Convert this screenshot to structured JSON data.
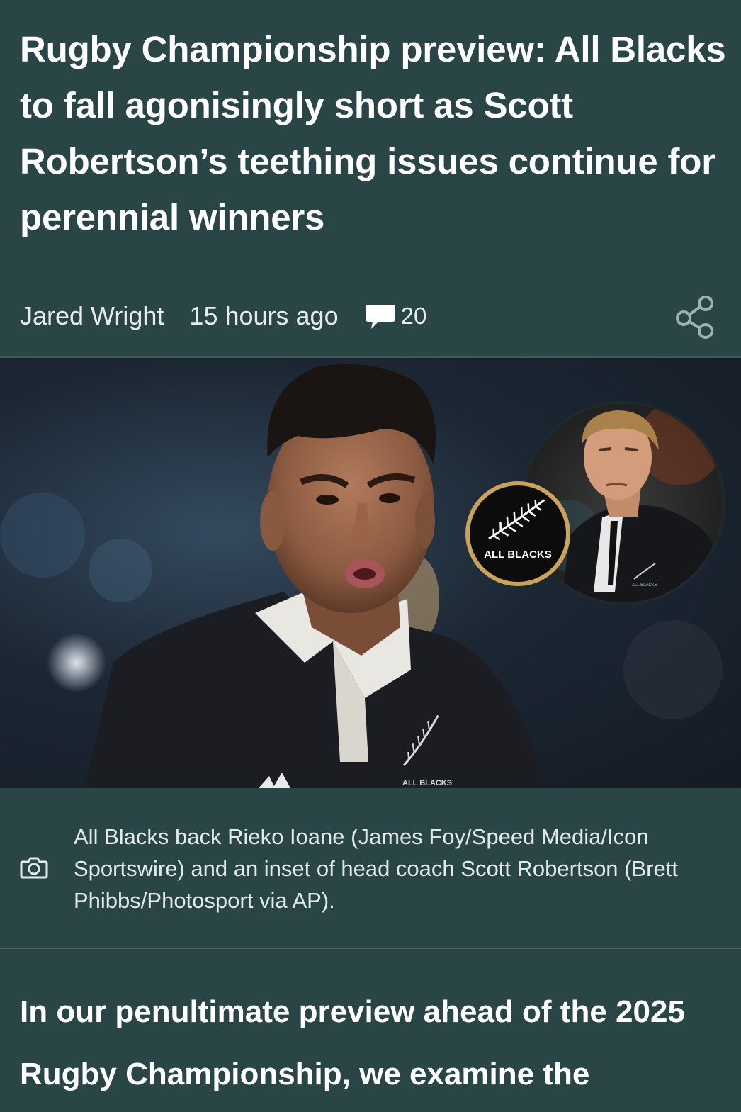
{
  "article": {
    "headline": "Rugby Championship preview: All Blacks to fall agonisingly short as Scott Robertson’s teething issues continue for perennial winners",
    "author": "Jared Wright",
    "published": "15 hours ago",
    "comment_count": "20",
    "share_icon": "share-icon",
    "comment_icon": "speech-bubble-icon"
  },
  "hero": {
    "badge_text": "ALL BLACKS",
    "jersey_text": "ALL BLACKS",
    "inset_jacket_text": "ALL BLACKS"
  },
  "caption": {
    "icon": "camera-icon",
    "text": "All Blacks back Rieko Ioane (James Foy/Speed Media/Icon Sportswire) and an inset of head coach Scott Robertson (Brett Phibbs/Photosport via AP)."
  },
  "body": {
    "lede": "In our penultimate preview ahead of the 2025 Rugby Championship, we examine the"
  },
  "colors": {
    "background": "#2a4545",
    "badge_ring": "#c9a35a",
    "text": "#ffffff"
  }
}
